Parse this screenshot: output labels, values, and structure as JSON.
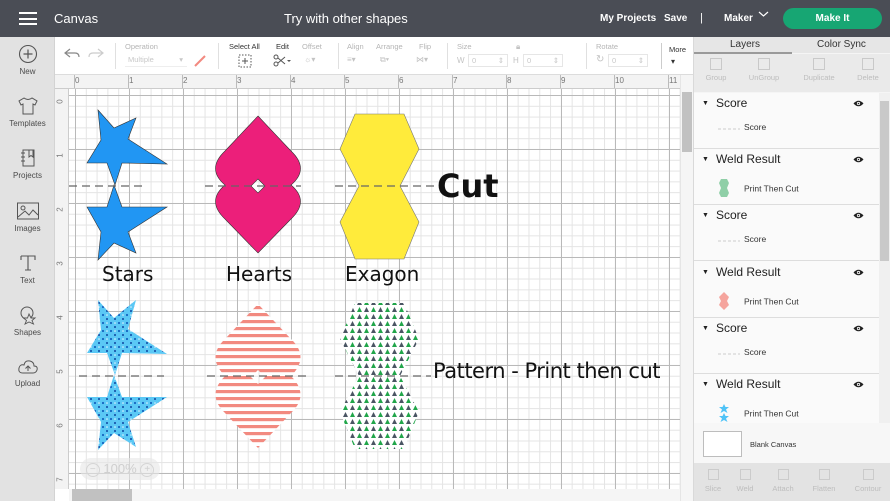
{
  "topbar": {
    "app_title": "Canvas",
    "project_title": "Try with other shapes",
    "my_projects": "My Projects",
    "save": "Save",
    "divider": "|",
    "machine": "Maker",
    "make_it": "Make It",
    "accent_color": "#17a673"
  },
  "leftnav": {
    "items": [
      {
        "label": "New",
        "icon": "plus-circle-icon"
      },
      {
        "label": "Templates",
        "icon": "tshirt-icon"
      },
      {
        "label": "Projects",
        "icon": "notebook-icon"
      },
      {
        "label": "Images",
        "icon": "image-icon"
      },
      {
        "label": "Text",
        "icon": "text-t-icon"
      },
      {
        "label": "Shapes",
        "icon": "shapes-icon"
      },
      {
        "label": "Upload",
        "icon": "cloud-upload-icon"
      }
    ]
  },
  "toolbar": {
    "operation_label": "Operation",
    "operation_value": "Multiple",
    "select_all": "Select All",
    "edit": "Edit",
    "offset": "Offset",
    "align": "Align",
    "arrange": "Arrange",
    "flip": "Flip",
    "size": "Size",
    "w_label": "W",
    "w_value": "0",
    "h_label": "H",
    "h_value": "0",
    "rotate": "Rotate",
    "rotate_value": "0",
    "more": "More"
  },
  "rulers": {
    "horizontal": [
      "0",
      "1",
      "2",
      "3",
      "4",
      "5",
      "6",
      "7",
      "8",
      "9",
      "10",
      "11"
    ],
    "vertical": [
      "0",
      "1",
      "2",
      "3",
      "4",
      "5",
      "6",
      "7"
    ]
  },
  "canvas": {
    "zoom_level": "100%",
    "zoom_out": "−",
    "zoom_in": "+",
    "labels": {
      "stars": "Stars",
      "hearts": "Hearts",
      "hexagon": "Exagon",
      "cut": "Cut",
      "pattern": "Pattern - Print then cut"
    },
    "colors": {
      "star": "#2196f3",
      "heart": "#ec1f7a",
      "hexagon": "#ffeb3b",
      "pattern_star": "#5bc8f5",
      "pattern_stripe": "#f28a80",
      "pattern_tree_green": "#21a64a",
      "pattern_tree_dark": "#4a5563"
    }
  },
  "rightpanel": {
    "tabs": [
      "Layers",
      "Color Sync"
    ],
    "actions": [
      "Group",
      "UnGroup",
      "Duplicate",
      "Delete"
    ],
    "layers": [
      {
        "title": "Score",
        "child": "Score",
        "thumb": "score-line"
      },
      {
        "title": "Weld Result",
        "child": "Print Then Cut",
        "thumb": "tree-hexagon"
      },
      {
        "title": "Score",
        "child": "Score",
        "thumb": "score-line"
      },
      {
        "title": "Weld Result",
        "child": "Print Then Cut",
        "thumb": "striped-heart"
      },
      {
        "title": "Score",
        "child": "Score",
        "thumb": "score-line"
      },
      {
        "title": "Weld Result",
        "child": "Print Then Cut",
        "thumb": "dotted-star"
      }
    ],
    "blank_canvas": "Blank Canvas",
    "bottom_actions": [
      "Slice",
      "Weld",
      "Attach",
      "Flatten",
      "Contour"
    ]
  }
}
